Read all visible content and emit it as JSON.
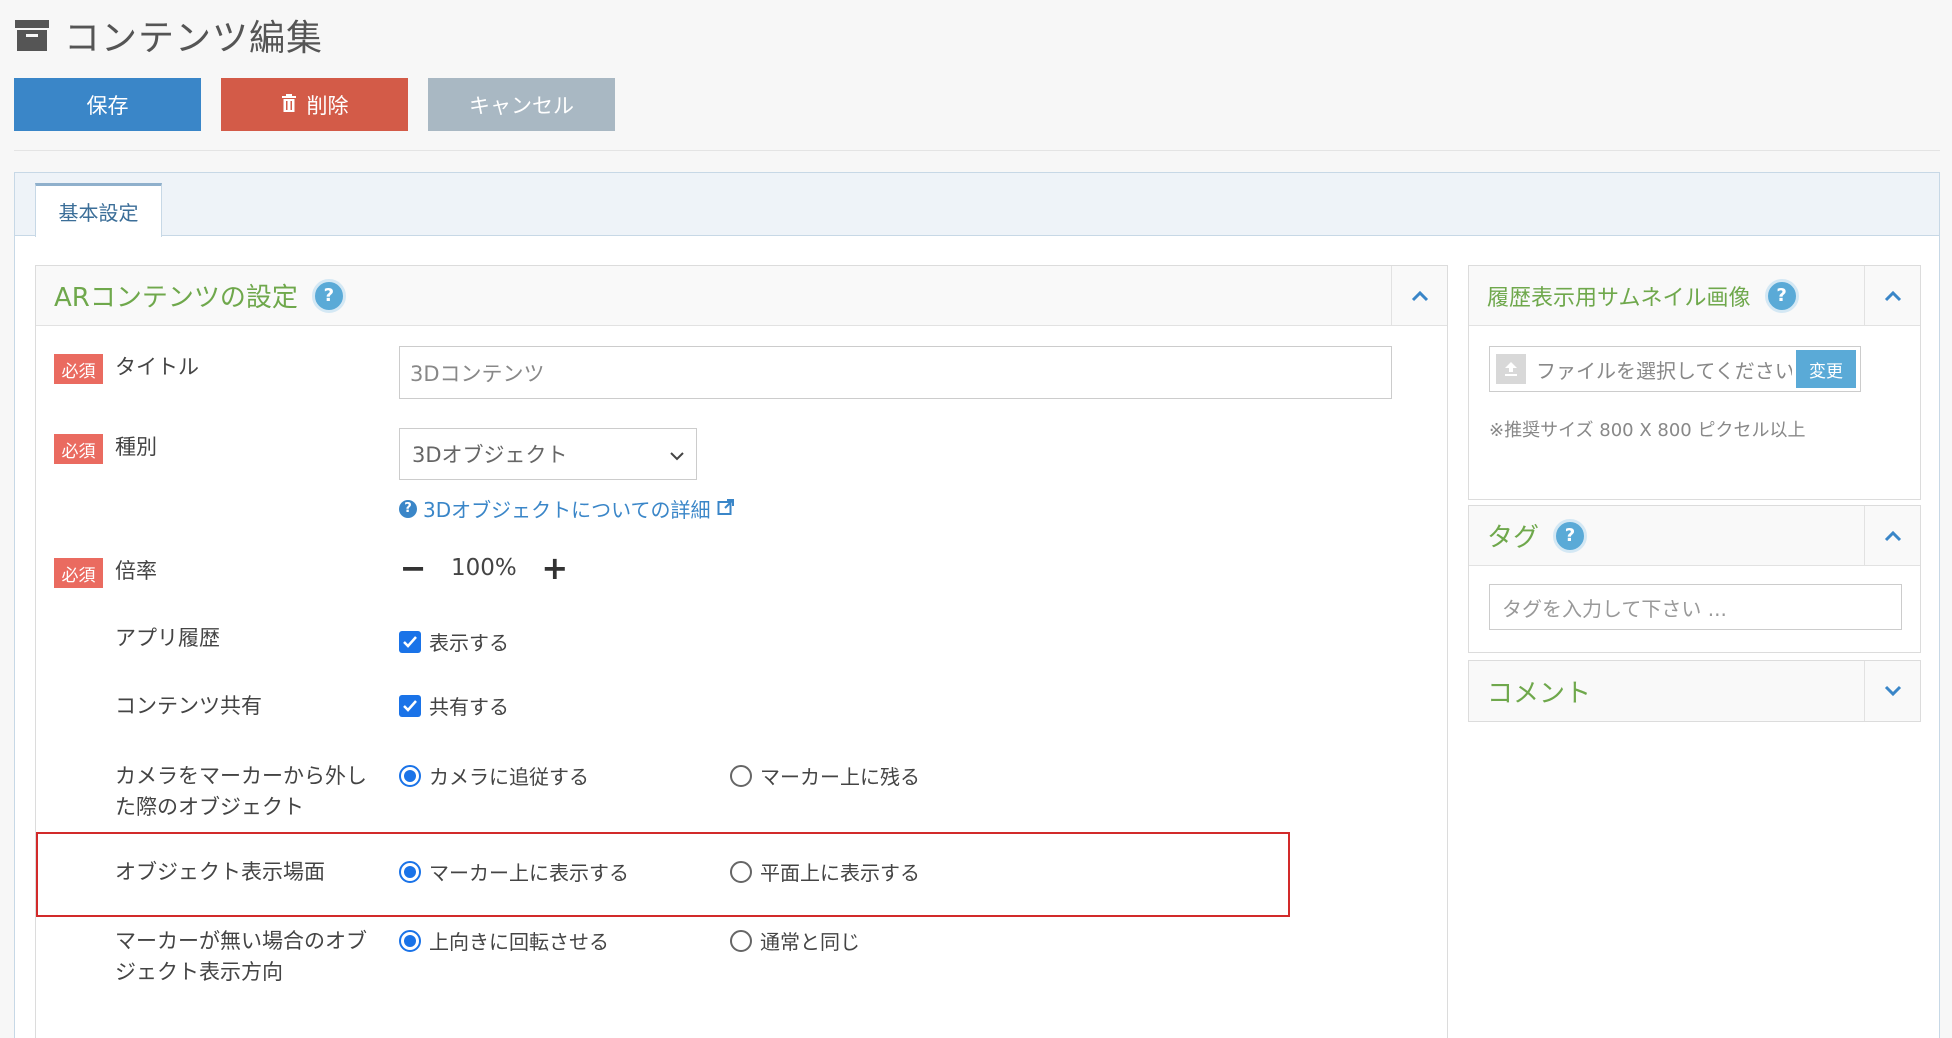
{
  "page": {
    "title": "コンテンツ編集"
  },
  "toolbar": {
    "save_label": "保存",
    "delete_label": "削除",
    "cancel_label": "キャンセル"
  },
  "tabs": [
    {
      "label": "基本設定"
    }
  ],
  "ar_settings": {
    "title": "ARコンテンツの設定",
    "help": "?",
    "required_badge": "必須",
    "title_field": {
      "label": "タイトル",
      "value": "3Dコンテンツ"
    },
    "type_field": {
      "label": "種別",
      "value": "3Dオブジェクト",
      "link": "3Dオブジェクトについての詳細"
    },
    "scale_field": {
      "label": "倍率",
      "value": "100%"
    },
    "app_history": {
      "label": "アプリ履歴",
      "option": "表示する",
      "checked": true
    },
    "content_share": {
      "label": "コンテンツ共有",
      "option": "共有する",
      "checked": true
    },
    "camera_release": {
      "label": "カメラをマーカーから外した際のオブジェクト",
      "options": [
        "カメラに追従する",
        "マーカー上に残る"
      ],
      "selected": 0
    },
    "display_scene": {
      "label": "オブジェクト表示場面",
      "options": [
        "マーカー上に表示する",
        "平面上に表示する"
      ],
      "selected": 0
    },
    "no_marker_direction": {
      "label": "マーカーが無い場合のオブジェクト表示方向",
      "options": [
        "上向きに回転させる",
        "通常と同じ"
      ],
      "selected": 0
    }
  },
  "thumbnail": {
    "title": "履歴表示用サムネイル画像",
    "help": "?",
    "file_placeholder": "ファイルを選択してください",
    "change_label": "変更",
    "hint": "※推奨サイズ 800 X 800 ピクセル以上"
  },
  "tags": {
    "title": "タグ",
    "help": "?",
    "placeholder": "タグを入力して下さい ..."
  },
  "comment": {
    "title": "コメント"
  },
  "colors": {
    "accent": "#3a86c8",
    "danger": "#d35b48",
    "muted": "#a9b8c3",
    "green_title": "#6fa84c",
    "required": "#ea6b60",
    "highlight": "#d22a2a"
  }
}
